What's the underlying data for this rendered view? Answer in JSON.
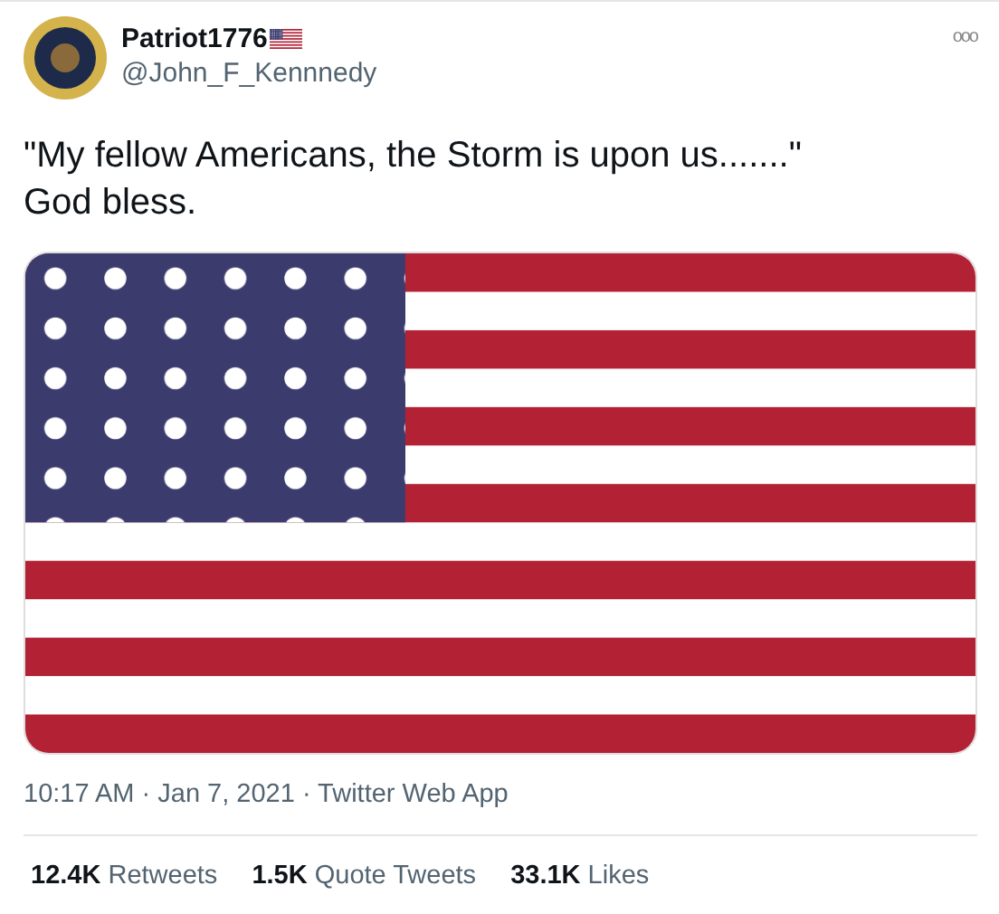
{
  "author": {
    "name": "Patriot1776",
    "handle": "@John_F_Kennnedy"
  },
  "more": "ooo",
  "text": [
    "\"My fellow Americans, the Storm is upon us.......\"",
    "God bless."
  ],
  "media": {
    "kind": "picture"
  },
  "meta": "10:17 AM · Jan 7, 2021 · Twitter Web App",
  "stats": [
    "**12.4K** Retweets",
    "**1.5K** Quote Tweets",
    "**33.1K** Likes"
  ]
}
